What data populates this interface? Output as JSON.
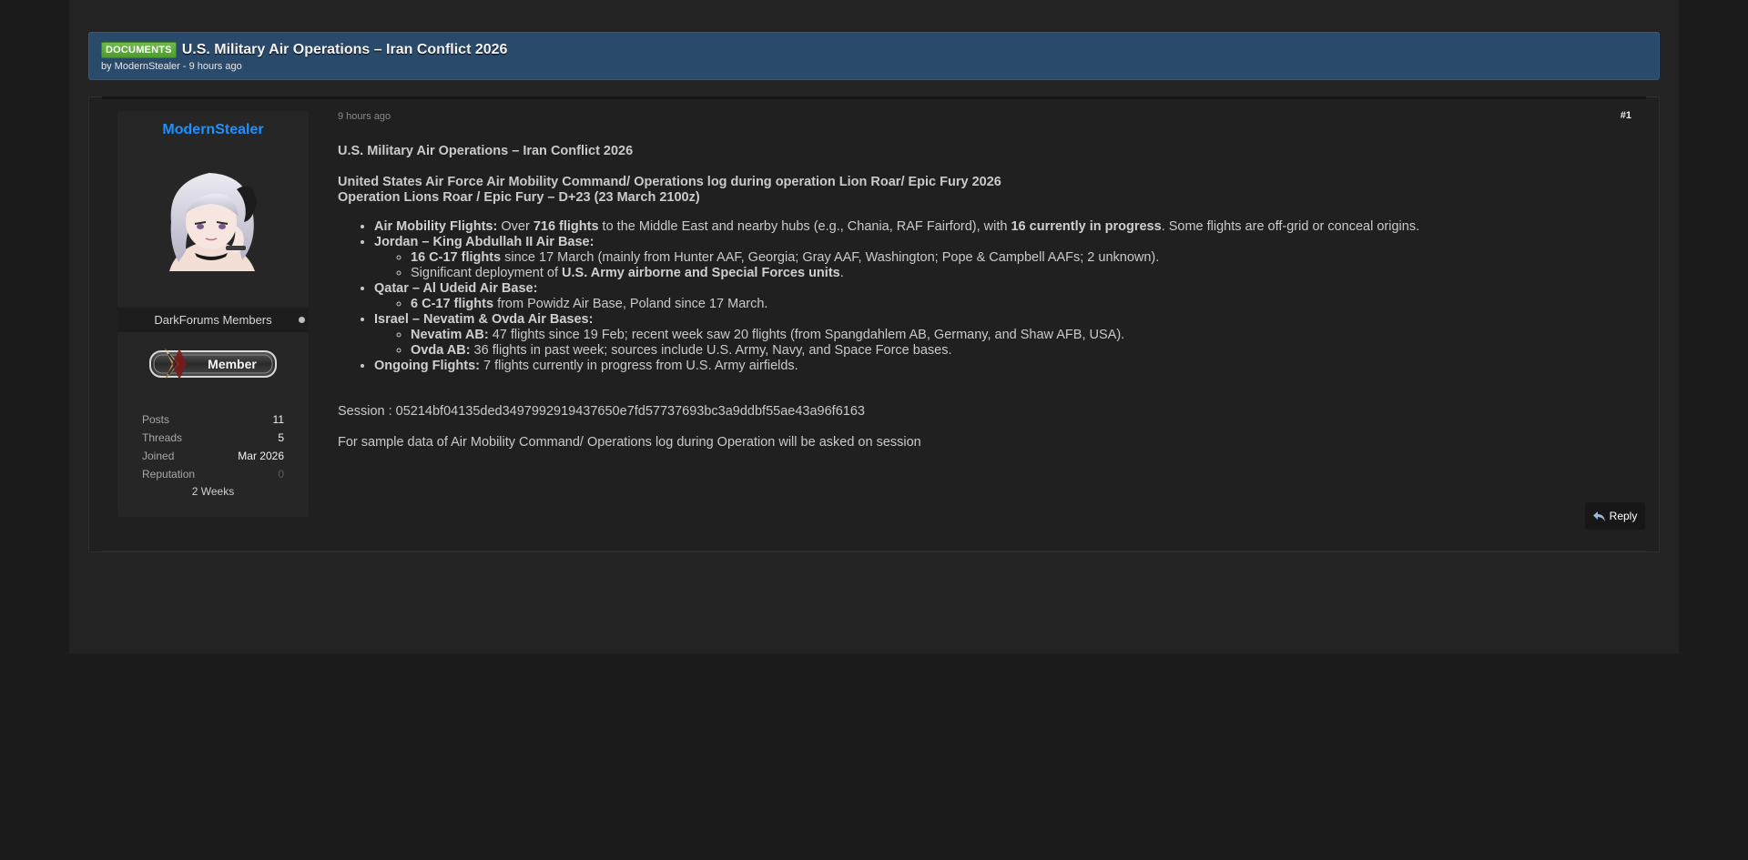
{
  "thread": {
    "prefix": "DOCUMENTS",
    "title": "U.S. Military Air Operations – Iran Conflict 2026",
    "byline": "by ModernStealer - 9 hours ago"
  },
  "user": {
    "name": "ModernStealer",
    "group": "DarkForums Members",
    "rank_label": "Member",
    "stats": {
      "posts_label": "Posts",
      "posts": "11",
      "threads_label": "Threads",
      "threads": "5",
      "joined_label": "Joined",
      "joined": "Mar 2026",
      "reputation_label": "Reputation",
      "reputation": "0",
      "footer": "2 Weeks"
    }
  },
  "post": {
    "date": "9 hours ago",
    "number": "#1",
    "title": "U.S. Military Air Operations – Iran Conflict 2026",
    "subtitle1": "United States Air Force Air Mobility Command/ Operations log during operation Lion Roar/ Epic Fury 2026",
    "subtitle2": "Operation Lions Roar / Epic Fury – D+23 (23 March 2100z)",
    "items": {
      "amf_label": "Air Mobility Flights:",
      "amf_t1": " Over ",
      "amf_b1": "716 flights",
      "amf_t2": " to the Middle East and nearby hubs (e.g., Chania, RAF Fairford), with ",
      "amf_b2": "16 currently in progress",
      "amf_t3": ". Some flights are off-grid or conceal origins.",
      "jordan_label": "Jordan – King Abdullah II Air Base:",
      "jordan_1_b": "16 C-17 flights",
      "jordan_1_t": " since 17 March (mainly from Hunter AAF, Georgia; Gray AAF, Washington; Pope & Campbell AAFs; 2 unknown).",
      "jordan_2_t1": "Significant deployment of ",
      "jordan_2_b": "U.S. Army airborne and Special Forces units",
      "jordan_2_t2": ".",
      "qatar_label": "Qatar – Al Udeid Air Base:",
      "qatar_1_b": "6 C-17 flights",
      "qatar_1_t": " from Powidz Air Base, Poland since 17 March.",
      "israel_label": "Israel – Nevatim & Ovda Air Bases:",
      "israel_1_b": "Nevatim AB:",
      "israel_1_t": " 47 flights since 19 Feb; recent week saw 20 flights (from Spangdahlem AB, Germany, and Shaw AFB, USA).",
      "israel_2_b": "Ovda AB:",
      "israel_2_t": " 36 flights in past week; sources include U.S. Army, Navy, and Space Force bases.",
      "ongoing_label": "Ongoing Flights:",
      "ongoing_t": " 7 flights currently in progress from U.S. Army airfields."
    },
    "session": "Session : 05214bf04135ded3497992919437650e7fd57737693bc3a9ddbf55ae43a96f6163",
    "sample": "For sample data of Air Mobility Command/ Operations log during Operation will be asked on session",
    "reply_label": "Reply"
  },
  "colors": {
    "header_bg": "#2a4a6b",
    "username": "#1e90ff",
    "prefix_badge": "#5aa838"
  },
  "icons": [
    "reply-icon",
    "online-status-icon",
    "avatar-image",
    "member-rank-badge"
  ]
}
